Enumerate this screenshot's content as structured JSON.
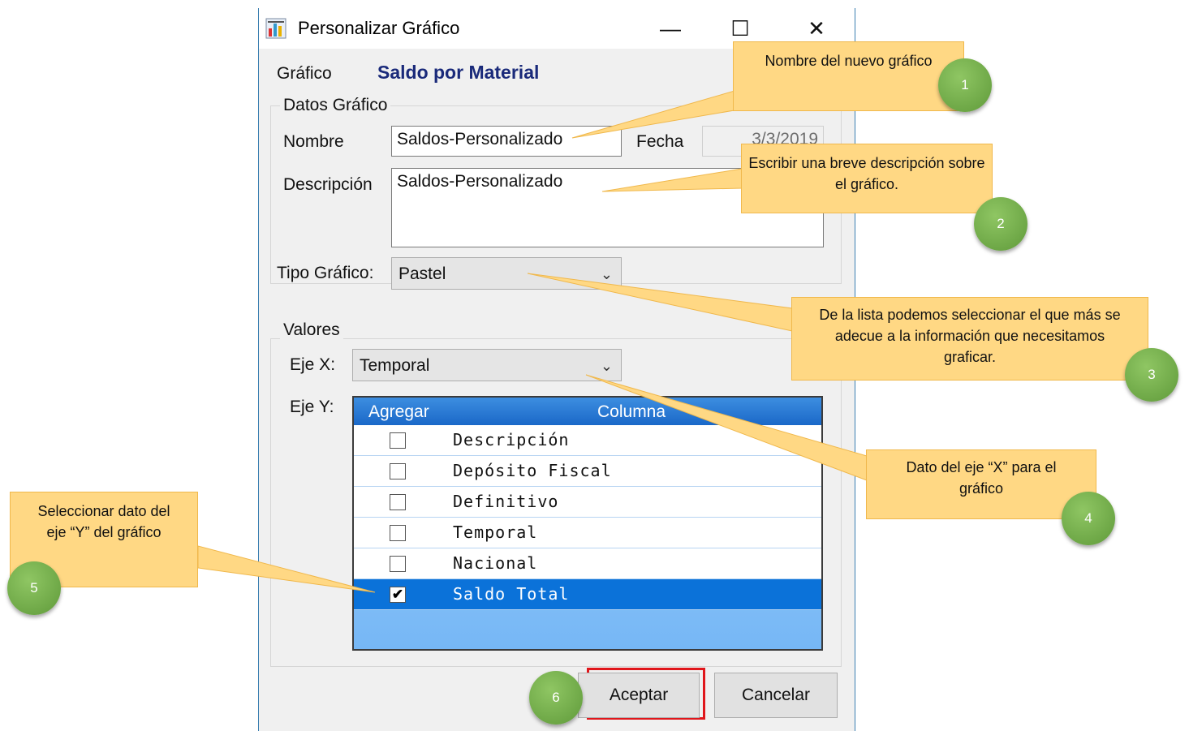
{
  "window": {
    "title": "Personalizar Gráfico",
    "minimize": "—",
    "maximize": "☐",
    "close": "✕",
    "app_icon": "chart-icon"
  },
  "chart_label": "Gráfico",
  "chart_name": "Saldo por Material",
  "datos_group": {
    "legend": "Datos Gráfico",
    "nombre_label": "Nombre",
    "nombre_value": "Saldos-Personalizado",
    "fecha_label": "Fecha",
    "fecha_value": "3/3/2019",
    "descripcion_label": "Descripción",
    "descripcion_value": "Saldos-Personalizado"
  },
  "tipo_label": "Tipo Gráfico:",
  "tipo_value": "Pastel",
  "valores_group": {
    "legend": "Valores",
    "eje_x_label": "Eje X:",
    "eje_x_value": "Temporal",
    "eje_y_label": "Eje Y:"
  },
  "grid": {
    "columns": [
      "Agregar",
      "Columna"
    ],
    "rows": [
      {
        "checked": false,
        "label": "Descripción"
      },
      {
        "checked": false,
        "label": "Depósito Fiscal"
      },
      {
        "checked": false,
        "label": "Definitivo"
      },
      {
        "checked": false,
        "label": "Temporal"
      },
      {
        "checked": false,
        "label": "Nacional"
      },
      {
        "checked": true,
        "label": "Saldo Total"
      }
    ]
  },
  "buttons": {
    "accept": "Aceptar",
    "cancel": "Cancelar"
  },
  "callouts": [
    {
      "number": "1",
      "text": "Nombre del nuevo gráfico"
    },
    {
      "number": "2",
      "text": "Escribir una breve descripción sobre el gráfico."
    },
    {
      "number": "3",
      "text": "De la lista podemos seleccionar el que más se adecue a la información que necesitamos graficar."
    },
    {
      "number": "4",
      "text": "Dato del eje “X” para el gráfico"
    },
    {
      "number": "5",
      "text": "Seleccionar dato del eje “Y” del gráfico"
    },
    {
      "number": "6",
      "text": ""
    }
  ],
  "colors": {
    "callout_fill": "#ffd884",
    "callout_border": "#f0b84c",
    "badge_green": "#6fa84a",
    "highlight_red": "#e0161b",
    "grid_header": "#1a68c8",
    "selected_row": "#0b72d9"
  }
}
